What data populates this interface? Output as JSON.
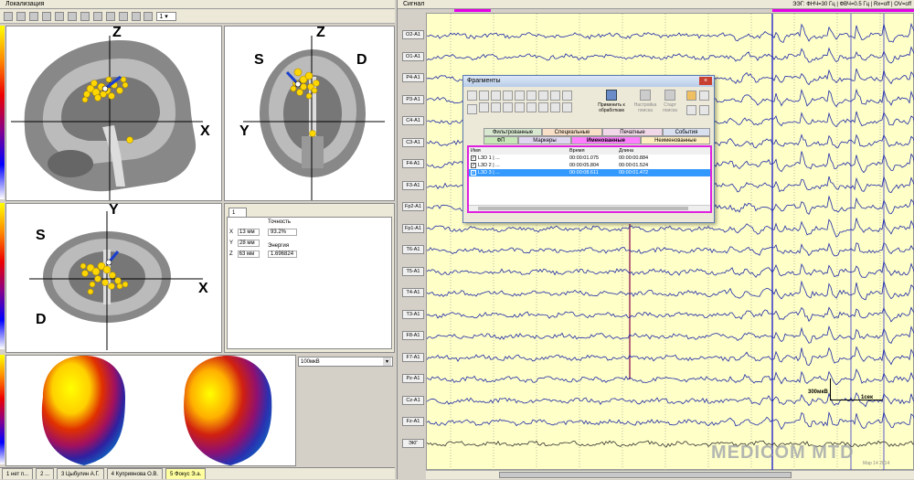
{
  "localization_window": {
    "title": "Локализация",
    "dropdown_value": "1",
    "views": {
      "sagittal": {
        "axis_top": "Z",
        "axis_right": "X"
      },
      "coronal": {
        "label_left": "S",
        "label_right": "D",
        "axis_top": "Z",
        "axis_left": "Y"
      },
      "axial": {
        "label_top_left": "S",
        "label_bottom_left": "D",
        "axis_top": "Y",
        "axis_right": "X"
      }
    },
    "info_panel": {
      "tab": "1",
      "rows": [
        {
          "axis": "X",
          "value": "13 мм"
        },
        {
          "axis": "Y",
          "value": "28 мм"
        },
        {
          "axis": "Z",
          "value": "63 мм"
        }
      ],
      "accuracy_label": "Точность",
      "accuracy_value": "93.2%",
      "energy_label": "Энергия",
      "energy_value": "1.696824"
    },
    "scale_select": "100мкВ"
  },
  "bottom_tabs": [
    "1 нет п...",
    "2 ...",
    "3 Цыбулин А.Г.",
    "4 Куприянова О.В.",
    "5 Фокус Э.а."
  ],
  "signal_window": {
    "title": "Сигнал",
    "filter_status": "ЭЭГ: ФНЧ=30 Гц | ФВЧ=0.5 Гц | Rx=off | OV=off",
    "channels": [
      "O2-A1",
      "O1-A1",
      "P4-A1",
      "P3-A1",
      "C4-A1",
      "C3-A1",
      "F4-A1",
      "F3-A1",
      "Fp2-A1",
      "Fp1-A1",
      "T6-A1",
      "T5-A1",
      "T4-A1",
      "T3-A1",
      "F8-A1",
      "F7-A1",
      "Pz-A1",
      "Cz-A1",
      "Fz-A1",
      "ЭКГ"
    ],
    "scale_label": "300мкВ",
    "time_label": "1сек",
    "watermark": "MEDICOM MTD",
    "watermark_date": "Мар 14 2014"
  },
  "fragments_dialog": {
    "title": "Фрагменты",
    "apply_button": "Применить к обработкам",
    "search_settings_button": "Настройка поиска",
    "start_search_button": "Старт поиска",
    "tabs_row1": [
      "Фильтрованные",
      "Специальные",
      "Печатные",
      "События"
    ],
    "tabs_row2": [
      "ФП",
      "Маркеры",
      "Именованные",
      "Неименованные"
    ],
    "columns": [
      "Имя",
      "Время",
      "Длина"
    ],
    "rows": [
      {
        "name": "L3D 1 | ...",
        "time": "00:00:01.075",
        "length": "00:00:00.884"
      },
      {
        "name": "L3D 2 | ...",
        "time": "00:00:05.804",
        "length": "00:00:01.524"
      },
      {
        "name": "L3D 3 | ...",
        "time": "00:00:08.611",
        "length": "00:00:01.472"
      }
    ]
  }
}
